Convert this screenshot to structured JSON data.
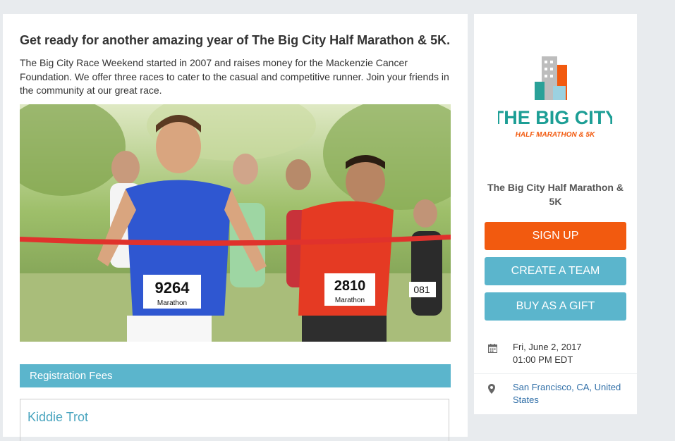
{
  "main": {
    "headline": "Get ready for another amazing year of The Big City Half Marathon & 5K.",
    "intro": "The Big City Race Weekend started in 2007 and raises money for the Mackenzie Cancer Foundation. We offer three races to cater to the casual and competitive runner. Join your friends in the community at our great race.",
    "hero_image": {
      "bib_left": "9264",
      "bib_right": "2810",
      "bib_label": "Marathon",
      "bib_partial": "081"
    },
    "fees_header": "Registration Fees",
    "fees": [
      {
        "title": "Kiddie Trot"
      }
    ]
  },
  "sidebar": {
    "logo": {
      "line1": "THE BIG CITY",
      "line2": "HALF MARATHON & 5K"
    },
    "event_name": "The Big City Half Marathon & 5K",
    "buttons": {
      "signup": "SIGN UP",
      "create_team": "CREATE A TEAM",
      "gift": "BUY AS A GIFT"
    },
    "date": "Fri, June 2, 2017",
    "time": "01:00 PM EDT",
    "location": "San Francisco, CA, United States"
  },
  "colors": {
    "accent_orange": "#f25a0f",
    "accent_teal": "#5bb5cc",
    "link_blue": "#2f6ea7"
  }
}
